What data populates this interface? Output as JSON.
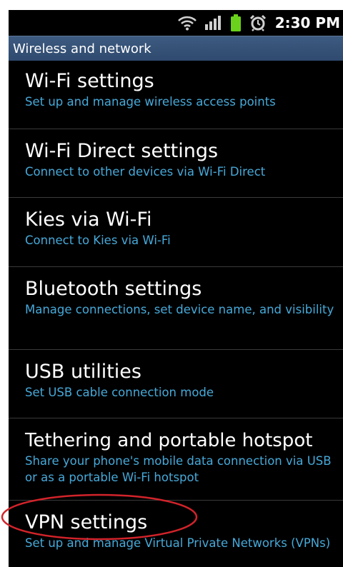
{
  "status_bar": {
    "time": "2:30 PM",
    "icons": [
      "wifi-icon",
      "signal-icon",
      "battery-icon",
      "alarm-icon"
    ]
  },
  "section_header": "Wireless and network",
  "colors": {
    "title": "#ffffff",
    "subtitle": "#46a9d9",
    "header_bg": "#3d5a80",
    "annotation": "#d2232a"
  },
  "items": [
    {
      "title": "Wi-Fi settings",
      "subtitle": "Set up and manage wireless access points"
    },
    {
      "title": "Wi-Fi Direct settings",
      "subtitle": "Connect to other devices via Wi-Fi Direct"
    },
    {
      "title": "Kies via Wi-Fi",
      "subtitle": "Connect to Kies via Wi-Fi"
    },
    {
      "title": "Bluetooth settings",
      "subtitle": "Manage connections, set device name, and visibility"
    },
    {
      "title": "USB utilities",
      "subtitle": "Set USB cable connection mode"
    },
    {
      "title": "Tethering and portable hotspot",
      "subtitle": "Share your phone's mobile data connection via USB or as a portable Wi-Fi hotspot"
    },
    {
      "title": "VPN settings",
      "subtitle": "Set up and manage Virtual Private Networks (VPNs)"
    }
  ]
}
